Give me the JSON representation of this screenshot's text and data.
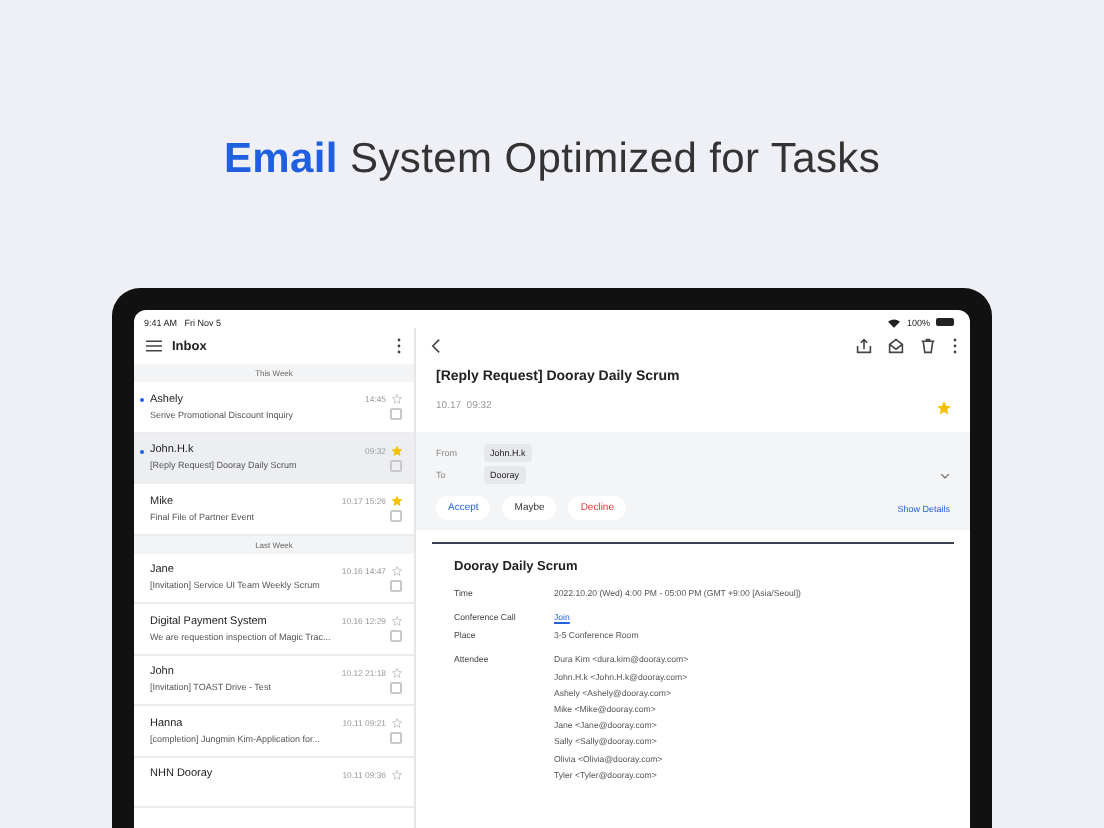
{
  "headline": {
    "highlight": "Email",
    "rest": "System Optimized for Tasks"
  },
  "status_bar": {
    "time": "9:41 AM",
    "date": "Fri Nov 5",
    "battery": "100%"
  },
  "inbox": {
    "title": "Inbox",
    "sections": [
      {
        "label": "This Week",
        "items": [
          {
            "sender": "Ashely",
            "time": "14:45",
            "subject": "Serive Promotional Discount Inquiry",
            "unread": true,
            "starred": false,
            "selected": false
          },
          {
            "sender": "John.H.k",
            "time": "09:32",
            "subject": "[Reply Request] Dooray Daily Scrum",
            "unread": true,
            "starred": true,
            "selected": true
          },
          {
            "sender": "Mike",
            "time": "10.17 15:26",
            "subject": "Final File of Partner Event",
            "unread": false,
            "starred": true,
            "selected": false
          }
        ]
      },
      {
        "label": "Last Week",
        "items": [
          {
            "sender": "Jane",
            "time": "10.16 14:47",
            "subject": "[Invitation] Service UI Team Weekly Scrum",
            "unread": false,
            "starred": false,
            "selected": false
          },
          {
            "sender": "Digital Payment System",
            "time": "10.16 12:29",
            "subject": "We are requestion inspection of Magic Trac...",
            "unread": false,
            "starred": false,
            "selected": false
          },
          {
            "sender": "John",
            "time": "10.12 21:18",
            "subject": "[Invitation] TOAST Drive - Test",
            "unread": false,
            "starred": false,
            "selected": false
          },
          {
            "sender": "Hanna",
            "time": "10.11 09:21",
            "subject": "[completion] Jungmin Kim-Application for...",
            "unread": false,
            "starred": false,
            "selected": false
          },
          {
            "sender": "NHN Dooray",
            "time": "10.11 09:36",
            "unread": false,
            "starred": false,
            "selected": false
          }
        ]
      }
    ]
  },
  "message": {
    "subject": "[Reply Request] Dooray Daily Scrum",
    "time": "10.17  09:32",
    "starred": true,
    "from_label": "From",
    "from": "John.H.k",
    "to_label": "To",
    "to": "Dooray",
    "responses": [
      {
        "label": "Accept",
        "kind": "accept"
      },
      {
        "label": "Maybe",
        "kind": "maybe"
      },
      {
        "label": "Decline",
        "kind": "decline"
      }
    ],
    "show_details": "Show Details",
    "event": {
      "title": "Dooray Daily Scrum",
      "rows": [
        {
          "label": "Time",
          "values": [
            "2022.10.20 (Wed) 4:00 PM - 05:00 PM (GMT +9:00 [Asia/Seoul])"
          ],
          "kind": "text"
        },
        {
          "label": "Conference Call",
          "values": [
            "Join"
          ],
          "kind": "link"
        },
        {
          "label": "Place",
          "values": [
            "3-5 Conference Room"
          ],
          "kind": "text"
        },
        {
          "label": "Attendee",
          "values": [
            "Dura Kim <dura.kim@dooray.com>",
            "John.H.k <John.H.k@dooray.com>",
            "Ashely <Ashely@dooray.com>",
            "Mike <Mike@dooray.com>",
            "Jane <Jane@dooray.com>",
            "Sally <Sally@dooray.com>",
            "Olivia <Olivia@dooray.com>",
            "Tyler <Tyler@dooray.com>"
          ],
          "kind": "text"
        }
      ]
    }
  }
}
